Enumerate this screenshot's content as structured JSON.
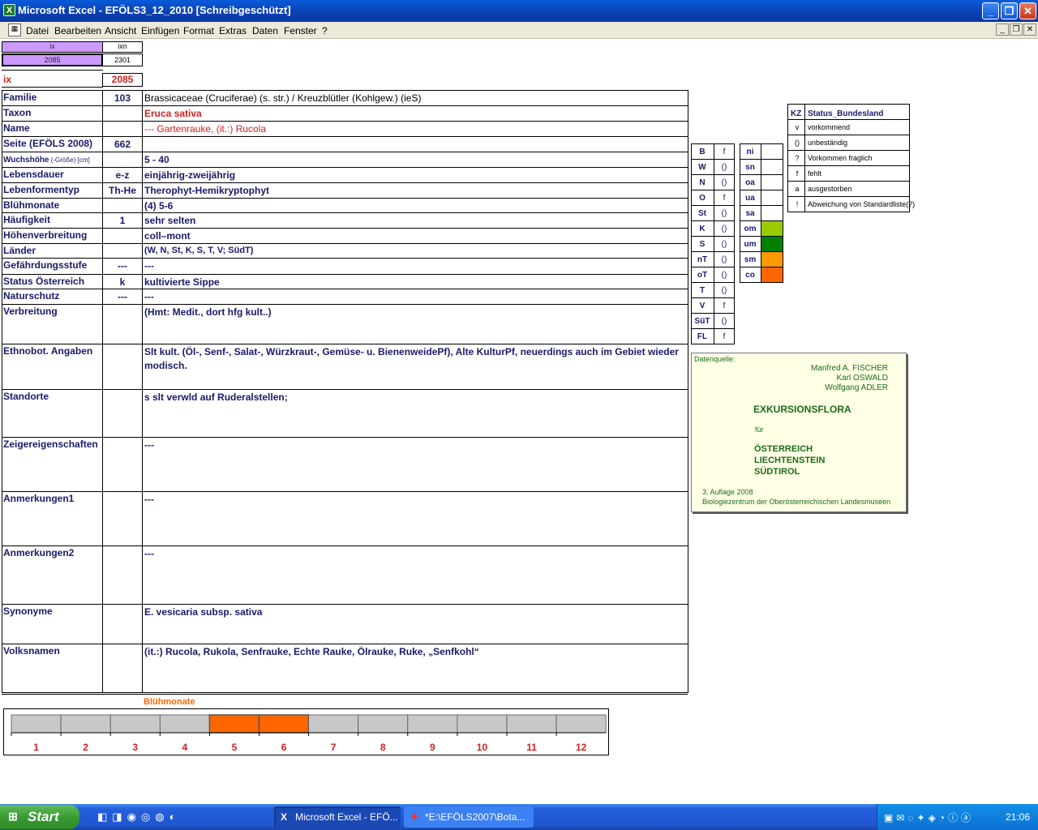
{
  "window": {
    "title": "Microsoft Excel - EFÖLS3_12_2010  [Schreibgeschützt]"
  },
  "menu": [
    "Datei",
    "Bearbeiten",
    "Ansicht",
    "Einfügen",
    "Format",
    "Extras",
    "Daten",
    "Fenster",
    "?"
  ],
  "top_cells": {
    "ix_label": "ix",
    "ixn_label": "ixn",
    "ix_value": "2085",
    "ixn_value": "2301",
    "ix_big_label": "ix",
    "ix_big_value": "2085"
  },
  "fields": [
    {
      "label": "Familie",
      "code": "103",
      "value": "Brassicaceae (Cruciferae) (s. str.)  /  Kreuzblütler (Kohlgew.) (ieS)"
    },
    {
      "label": "Taxon",
      "code": "",
      "value": "Eruca sativa"
    },
    {
      "label": "Name",
      "code": "",
      "value": "--- Gartenrauke, (it.:) Rucola"
    },
    {
      "label": "Seite (EFÖLS 2008)",
      "code": "662",
      "value": ""
    },
    {
      "label": "Wuchshöhe",
      "label_small": " (-Größe) [cm]",
      "code": "",
      "value": " 5 - 40"
    },
    {
      "label": "Lebensdauer",
      "code": "e-z",
      "value": "einjährig-zweijährig"
    },
    {
      "label": "Lebenformentyp",
      "code": "Th-He",
      "value": "Therophyt-Hemikryptophyt"
    },
    {
      "label": "Blühmonate",
      "code": "",
      "value": "(4) 5-6"
    },
    {
      "label": "Häufigkeit",
      "code": "1",
      "value": "sehr selten"
    },
    {
      "label": "Höhenverbreitung",
      "code": "",
      "value": "coll–mont"
    },
    {
      "label": "Länder",
      "code": "",
      "value": "(W, N, St, K, S, T, V; SüdT)"
    },
    {
      "label": "Gefährdungsstufe",
      "code": "---",
      "value": "  ---"
    },
    {
      "label": "Status Österreich",
      "code": "k",
      "value": "kultivierte Sippe"
    },
    {
      "label": "Naturschutz",
      "code": "---",
      "value": " ---"
    },
    {
      "label": "Verbreitung",
      "code": "",
      "value": "(Hmt: Medit., dort hfg kult..)"
    },
    {
      "label": "Ethnobot. Angaben",
      "code": "",
      "value": "Slt kult. (Öl-, Senf-, Salat-, Würzkraut-, Gemüse- u. BienenweidePf),  Alte KulturPf, neuerdings auch im Gebiet wieder",
      "value2": "modisch."
    },
    {
      "label": "Standorte",
      "code": "",
      "value": " s slt verwld auf Ruderalstellen;"
    },
    {
      "label": "Zeigereigenschaften",
      "code": "",
      "value": "---"
    },
    {
      "label": "Anmerkungen1",
      "code": "",
      "value": "---"
    },
    {
      "label": "Anmerkungen2",
      "code": "",
      "value": "---"
    },
    {
      "label": "Synonyme",
      "code": "",
      "value": "E. vesicaria subsp. sativa"
    },
    {
      "label": "Volksnamen",
      "code": "",
      "value": "(it.:) Rucola,  Rukola, Senfrauke, Echte Rauke, Ölrauke, Ruke, „Senfkohl“"
    }
  ],
  "regions": [
    {
      "code": "B",
      "val": "f"
    },
    {
      "code": "W",
      "val": "()"
    },
    {
      "code": "N",
      "val": "()"
    },
    {
      "code": "O",
      "val": "f"
    },
    {
      "code": "St",
      "val": "()"
    },
    {
      "code": "K",
      "val": "()"
    },
    {
      "code": "S",
      "val": "()"
    },
    {
      "code": "nT",
      "val": "()"
    },
    {
      "code": "oT",
      "val": "()"
    },
    {
      "code": "T",
      "val": "()"
    },
    {
      "code": "V",
      "val": "f"
    },
    {
      "code": "SüT",
      "val": "()"
    },
    {
      "code": "FL",
      "val": "f"
    }
  ],
  "zones": [
    {
      "code": "ni",
      "color": ""
    },
    {
      "code": "sn",
      "color": ""
    },
    {
      "code": "oa",
      "color": ""
    },
    {
      "code": "ua",
      "color": ""
    },
    {
      "code": "sa",
      "color": ""
    },
    {
      "code": "om",
      "color": "#99cc00"
    },
    {
      "code": "um",
      "color": "#008000"
    },
    {
      "code": "sm",
      "color": "#ff9900"
    },
    {
      "code": "co",
      "color": "#ff6600"
    }
  ],
  "status_legend": {
    "header_kz": "KZ",
    "header_title": "Status_Bundesland",
    "rows": [
      {
        "kz": "v",
        "text": "vorkommend"
      },
      {
        "kz": "()",
        "text": "unbeständig"
      },
      {
        "kz": "?",
        "text": "Vorkommen fraglich"
      },
      {
        "kz": "f",
        "text": "fehlt"
      },
      {
        "kz": "a",
        "text": "ausgestorben"
      },
      {
        "kz": "!",
        "text": "Abweichung von Standardliste(?)"
      }
    ]
  },
  "book": {
    "source_label": "Datenquelle:",
    "authors": [
      "Manfred A. FISCHER",
      "Karl OSWALD",
      "Wolfgang ADLER"
    ],
    "title": "EXKURSIONSFLORA",
    "fuer": "für",
    "countries": [
      "ÖSTERREICH",
      "LIECHTENSTEIN",
      "SÜDTIROL"
    ],
    "edition": "3. Auflage 2008",
    "publisher": "Biologiezentrum der Oberösterreichischen Landesmuseen"
  },
  "bloom_chart": {
    "title": "Blühmonate",
    "months": [
      "1",
      "2",
      "3",
      "4",
      "5",
      "6",
      "7",
      "8",
      "9",
      "10",
      "11",
      "12"
    ],
    "active": [
      false,
      false,
      false,
      false,
      true,
      true,
      false,
      false,
      false,
      false,
      false,
      false
    ],
    "active_color": "#ff6600",
    "inactive_color": "#c8c8c8"
  },
  "taskbar": {
    "start": "Start",
    "tasks": [
      "Microsoft Excel - EFÖ...",
      "*E:\\EFÖLS2007\\Bota..."
    ],
    "clock": "21:06"
  }
}
